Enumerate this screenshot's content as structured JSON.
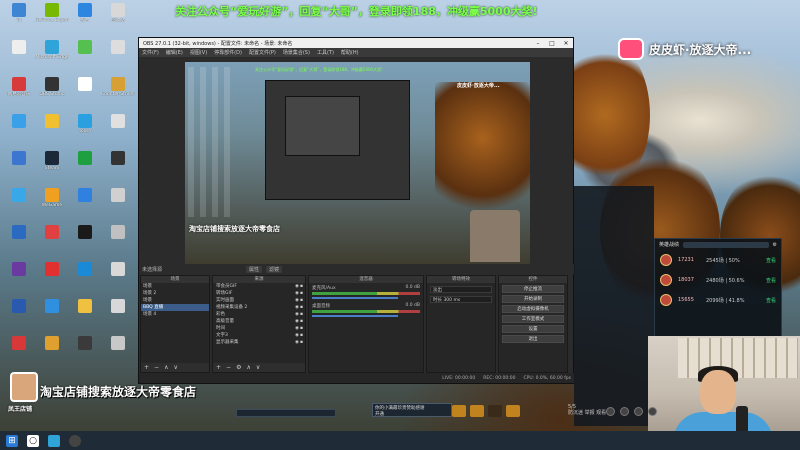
{
  "banner": {
    "text": "关注公众号“爱玩好游”，回复“大哥”，登录即领188，冲级赢5000大奖!"
  },
  "brand": {
    "name": "皮皮虾·放逐大帝..."
  },
  "desktop_icons": [
    {
      "label": "Ta",
      "color": "#3e86d4"
    },
    {
      "label": "GeForce Experience",
      "color": "#76b900"
    },
    {
      "label": "照片",
      "color": "#2d86e0"
    },
    {
      "label": "回收站",
      "color": "#d8d8d8"
    },
    {
      "label": "",
      "color": "#eeeeee"
    },
    {
      "label": "Microsoft Edge",
      "color": "#2fa4d8"
    },
    {
      "label": "",
      "color": "#55c050"
    },
    {
      "label": "",
      "color": "#dddddd"
    },
    {
      "label": "网易云音乐",
      "color": "#d63a3a"
    },
    {
      "label": "OBS Studio",
      "color": "#333333"
    },
    {
      "label": "",
      "color": "#ffffff"
    },
    {
      "label": "Counter-Strike Global",
      "color": "#d6a034"
    },
    {
      "label": "",
      "color": "#3aa0e8"
    },
    {
      "label": "",
      "color": "#f0c030"
    },
    {
      "label": "Yolish",
      "color": "#2aa0e0"
    },
    {
      "label": "",
      "color": "#e0e0e0"
    },
    {
      "label": "",
      "color": "#3c76d0"
    },
    {
      "label": "Steam",
      "color": "#1b2838"
    },
    {
      "label": "",
      "color": "#1fa040"
    },
    {
      "label": "",
      "color": "#333333"
    },
    {
      "label": "",
      "color": "#38a8e8"
    },
    {
      "label": "WeGame",
      "color": "#f0a020"
    },
    {
      "label": "",
      "color": "#3080e0"
    },
    {
      "label": "",
      "color": "#d0d0d0"
    },
    {
      "label": "",
      "color": "#2a6ac0"
    },
    {
      "label": "",
      "color": "#e04040"
    },
    {
      "label": "",
      "color": "#1a1a1a"
    },
    {
      "label": "",
      "color": "#c0c0c0"
    },
    {
      "label": "",
      "color": "#6a3aa0"
    },
    {
      "label": "",
      "color": "#e03030"
    },
    {
      "label": "",
      "color": "#1a8ad8"
    },
    {
      "label": "",
      "color": "#d8d8d8"
    },
    {
      "label": "",
      "color": "#2a5ab0"
    },
    {
      "label": "",
      "color": "#3090e0"
    },
    {
      "label": "",
      "color": "#f0c040"
    },
    {
      "label": "",
      "color": "#d8d8d8"
    },
    {
      "label": "",
      "color": "#d83838"
    },
    {
      "label": "",
      "color": "#e0a030"
    },
    {
      "label": "",
      "color": "#3a3a3a"
    },
    {
      "label": "",
      "color": "#c8c8c8"
    }
  ],
  "obs": {
    "title": "OBS 27.0.1 (32-bit, windows) - 配置文件: 未命名 - 场景: 未命名",
    "menu": [
      "文件(F)",
      "编辑(E)",
      "视图(V)",
      "停靠部件(D)",
      "配置文件(P)",
      "场景集合(S)",
      "工具(T)",
      "帮助(H)"
    ],
    "scene_bar": {
      "current": "未选择源",
      "buttons": [
        "属性",
        "滤镜"
      ]
    },
    "scenes": {
      "header": "场景",
      "items": [
        "场景",
        "场景 2",
        "场景",
        "BBQ 直播",
        "场景 4"
      ]
    },
    "sources": {
      "header": "来源",
      "items": [
        "带会员GIF",
        "转场GIF",
        "实时画面",
        "视频采集设备 2",
        "彩色",
        "高级音量",
        "时间",
        "文字3",
        "显示器采集"
      ]
    },
    "mixer": {
      "header": "混音器",
      "channels": [
        {
          "name": "麦克风/Aux",
          "db": "0.0 dB"
        },
        {
          "name": "桌面音频",
          "db": "0.0 dB"
        }
      ]
    },
    "transitions": {
      "header": "转场特效",
      "type": "淡出",
      "duration_label": "时长",
      "duration": "300 ms"
    },
    "controls": {
      "header": "控件",
      "buttons": [
        "停止推流",
        "开始录制",
        "启动虚拟摄像机",
        "工作室模式",
        "设置",
        "退出"
      ]
    },
    "status": [
      "LIVE: 00:00:00",
      "REC: 00:00:00",
      "CPU: 0.0%, 60.00 fps"
    ]
  },
  "game_list": {
    "title": "英雄战绩",
    "rows": [
      {
        "score": "17231",
        "stat": "2545场 | 50%",
        "action": "查看"
      },
      {
        "score": "18037",
        "stat": "2480场 | 50.6%",
        "action": "查看"
      },
      {
        "score": "15655",
        "stat": "2099场 | 41.8%",
        "action": "查看"
      }
    ]
  },
  "overlay": {
    "taobao": "淘宝店铺搜索放逐大帝零食店",
    "streamer": "凤王店铺"
  },
  "donation": {
    "text": "你的小满最珍贵赞助感谢",
    "sub": "开通"
  },
  "rt_controls": {
    "line1": "5/5",
    "line2": "防沉迷 举报 观看"
  },
  "taskbar": [
    "start-icon",
    "search-icon",
    "edge-icon",
    "obs-icon"
  ]
}
